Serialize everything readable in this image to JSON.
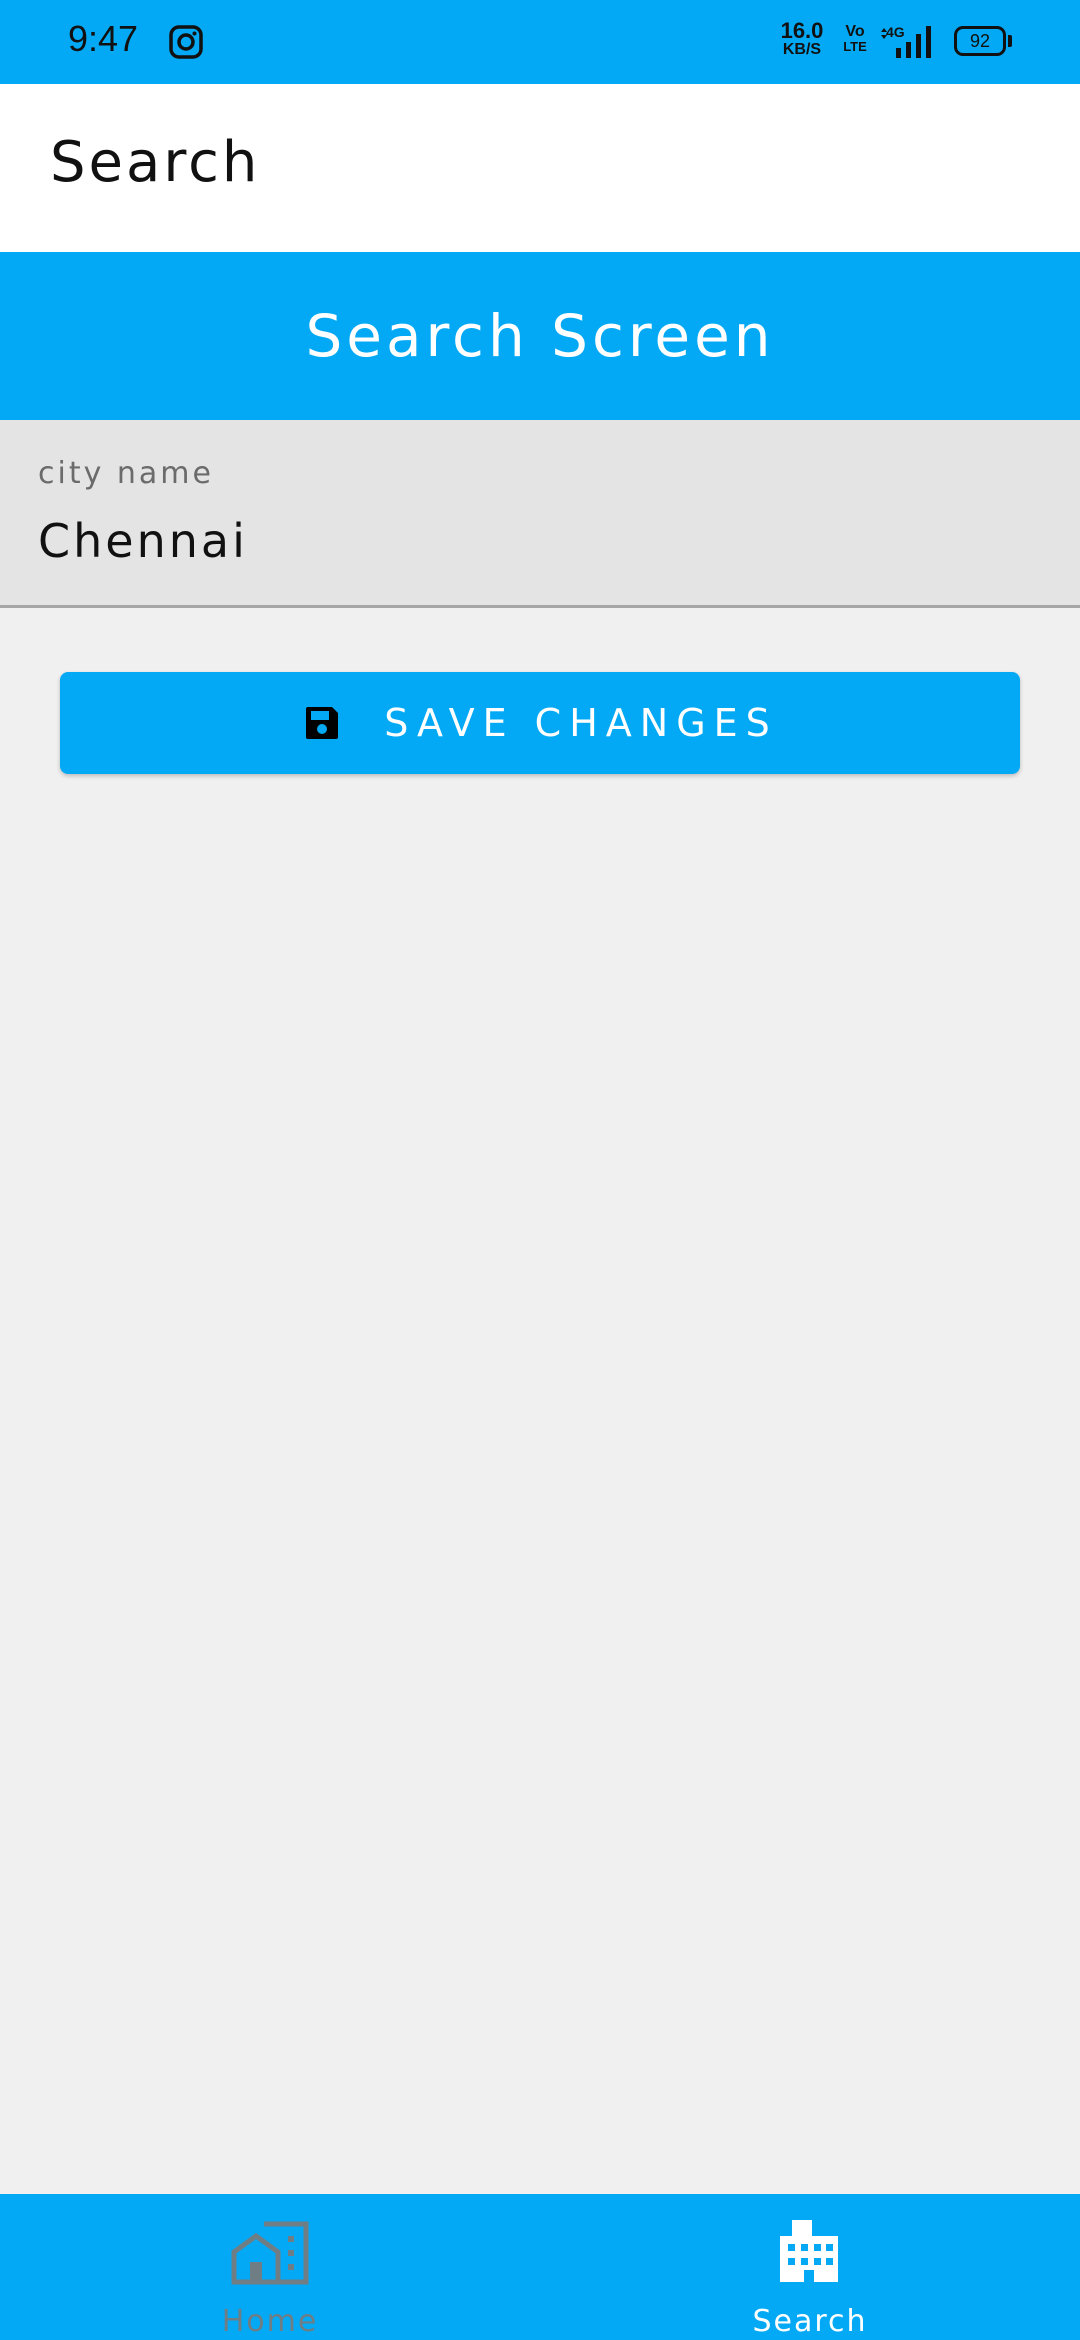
{
  "status_bar": {
    "time": "9:47",
    "net_speed_value": "16.0",
    "net_speed_unit": "KB/S",
    "volte_top": "Vo",
    "volte_bottom": "LTE",
    "network_type": "4G",
    "battery_level": "92"
  },
  "app_bar": {
    "title": "Search"
  },
  "header": {
    "title": "Search Screen"
  },
  "city_field": {
    "label": "city name",
    "value": "Chennai"
  },
  "save_button": {
    "label": "SAVE CHANGES",
    "icon": "floppy-disk-icon"
  },
  "bottom_nav": {
    "items": [
      {
        "label": "Home",
        "icon": "home-icon",
        "active": false
      },
      {
        "label": "Search",
        "icon": "city-buildings-icon",
        "active": true
      }
    ]
  },
  "colors": {
    "primary": "#03a9f4",
    "background": "#f0f0f0",
    "field_background": "#e4e4e4",
    "inactive_nav": "#6f7d85"
  }
}
